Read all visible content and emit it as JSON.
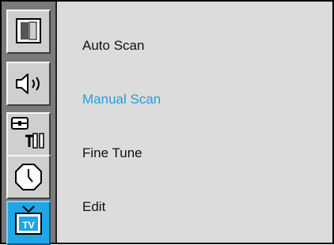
{
  "sidebar": {
    "icons": [
      {
        "name": "picture-icon"
      },
      {
        "name": "sound-icon"
      },
      {
        "name": "setup-tools-icon"
      },
      {
        "name": "clock-icon"
      },
      {
        "name": "tv-icon",
        "label": "TV",
        "active": true
      }
    ]
  },
  "menu": {
    "items": [
      {
        "label": "Auto Scan"
      },
      {
        "label": "Manual Scan",
        "selected": true
      },
      {
        "label": "Fine Tune"
      },
      {
        "label": "Edit"
      }
    ]
  },
  "colors": {
    "accent": "#1ea0e0",
    "panel": "#dcdcdc",
    "sidebar": "#7a7a7a"
  }
}
